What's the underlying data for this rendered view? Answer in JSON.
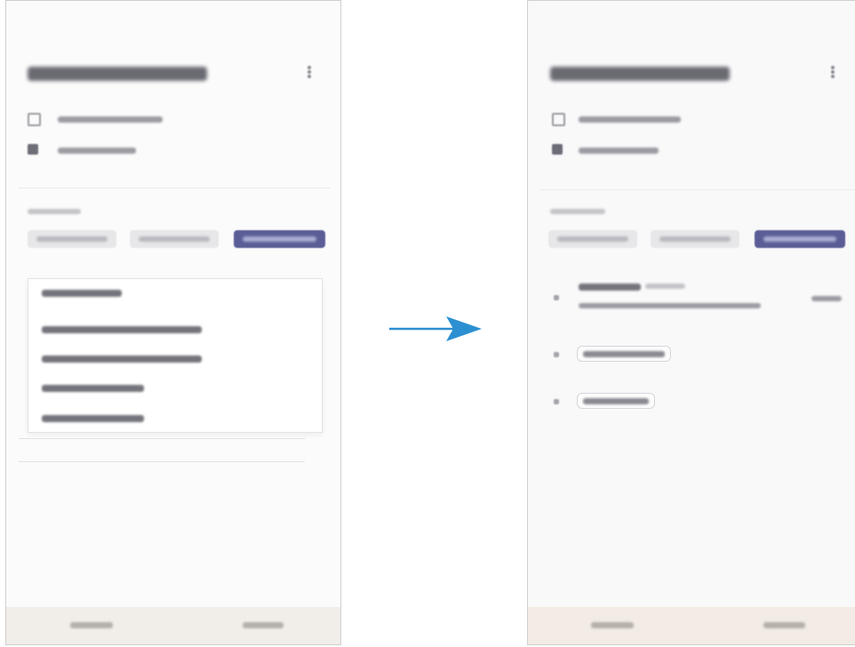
{
  "colors": {
    "accent": "#5b5d96",
    "arrow": "#2b8fd1",
    "footer": "#f1ede8",
    "frame": "#cfcfcf"
  },
  "icons": {
    "header_menu": "more-icon",
    "row_1": "checkbox-outline-icon",
    "row_2": "checkbox-filled-icon",
    "transition": "arrow-right-icon",
    "list_item": "drag-handle-icon"
  }
}
